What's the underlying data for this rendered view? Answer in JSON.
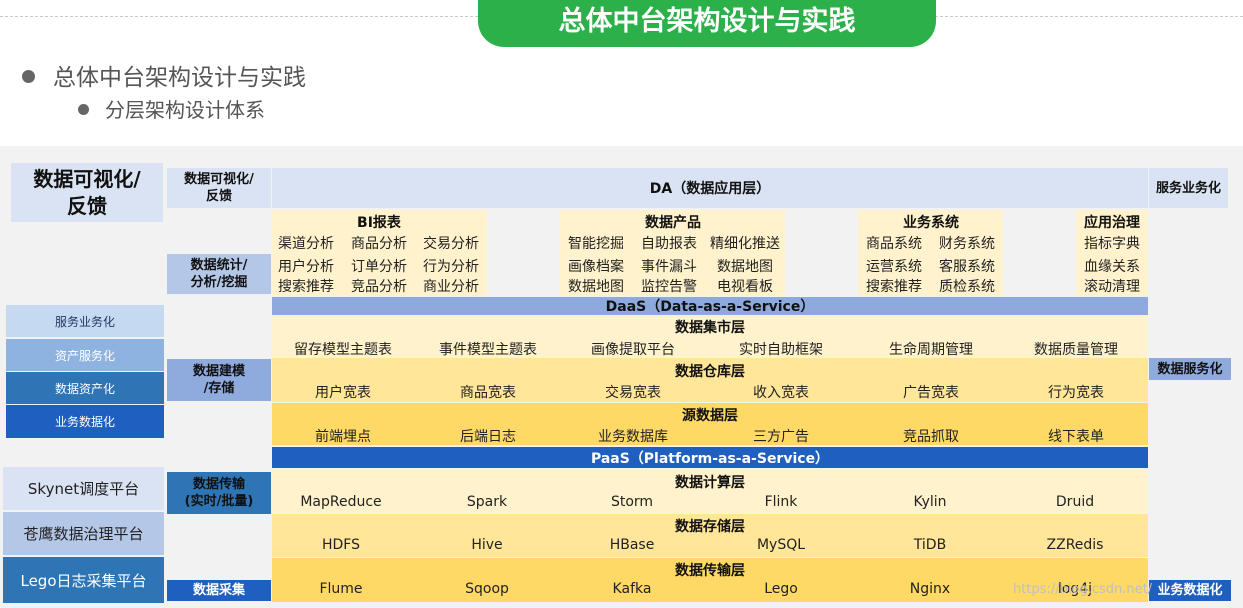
{
  "title": "总体中台架构设计与实践",
  "bullets": {
    "level1": "总体中台架构设计与实践",
    "level2": "分层架构设计体系"
  },
  "left_panel": {
    "big_title": "数据可视化/\n反馈",
    "stack": [
      "服务业务化",
      "资产服务化",
      "数据资产化",
      "业务数据化"
    ],
    "platforms": [
      "Skynet调度平台",
      "苍鹰数据治理平台",
      "Lego日志采集平台"
    ]
  },
  "row_labels": {
    "viz": "数据可视化/\n反馈",
    "stat": "数据统计/\n分析/挖掘",
    "model": "数据建模\n/存储",
    "transfer": "数据传输\n(实时/批量)",
    "collect": "数据采集"
  },
  "right_labels": {
    "service_biz": "服务业务化",
    "data_service": "数据服务化",
    "data_biz": "业务数据化"
  },
  "da": {
    "title": "DA（数据应用层）",
    "groups": [
      {
        "title": "BI报表",
        "rows": [
          [
            "渠道分析",
            "商品分析",
            "交易分析"
          ],
          [
            "用户分析",
            "订单分析",
            "行为分析"
          ],
          [
            "搜索推荐",
            "竞品分析",
            "商业分析"
          ]
        ]
      },
      {
        "title": "数据产品",
        "rows": [
          [
            "智能挖掘",
            "自助报表",
            "精细化推送"
          ],
          [
            "画像档案",
            "事件漏斗",
            "数据地图"
          ],
          [
            "数据地图",
            "监控告警",
            "电视看板"
          ]
        ]
      },
      {
        "title": "业务系统",
        "rows": [
          [
            "商品系统",
            "财务系统"
          ],
          [
            "运营系统",
            "客服系统"
          ],
          [
            "搜索推荐",
            "质检系统"
          ]
        ]
      },
      {
        "title": "应用治理",
        "rows": [
          [
            "指标字典"
          ],
          [
            "血缘关系"
          ],
          [
            "滚动清理"
          ]
        ]
      }
    ]
  },
  "daas": {
    "title": "DaaS（Data-as-a-Service）",
    "layers": [
      {
        "title": "数据集市层",
        "items": [
          "留存模型主题表",
          "事件模型主题表",
          "画像提取平台",
          "实时自助框架",
          "生命周期管理",
          "数据质量管理"
        ]
      },
      {
        "title": "数据仓库层",
        "items": [
          "用户宽表",
          "商品宽表",
          "交易宽表",
          "收入宽表",
          "广告宽表",
          "行为宽表"
        ]
      },
      {
        "title": "源数据层",
        "items": [
          "前端埋点",
          "后端日志",
          "业务数据库",
          "三方广告",
          "竞品抓取",
          "线下表单"
        ]
      }
    ]
  },
  "paas": {
    "title": "PaaS（Platform-as-a-Service）",
    "layers": [
      {
        "title": "数据计算层",
        "items": [
          "MapReduce",
          "Spark",
          "Storm",
          "Flink",
          "Kylin",
          "Druid"
        ]
      },
      {
        "title": "数据存储层",
        "items": [
          "HDFS",
          "Hive",
          "HBase",
          "MySQL",
          "TiDB",
          "ZZRedis"
        ]
      },
      {
        "title": "数据传输层",
        "items": [
          "Flume",
          "Sqoop",
          "Kafka",
          "Lego",
          "Nginx",
          "log4j"
        ]
      }
    ]
  },
  "watermark": "https://blog.csdn.net/",
  "colors": {
    "green": "#2bb04a",
    "lavender": "#dae3f3",
    "label_blue": "#b4c7e7",
    "mid_blue": "#8faadc",
    "dark_blue": "#2e75b6",
    "navy": "#1f4e9c",
    "daas_blue": "#8ea9db",
    "paas_blue": "#1f5fbf",
    "sand_light": "#fff2cc",
    "sand_mid": "#ffe699",
    "sand_dark": "#ffd966"
  }
}
